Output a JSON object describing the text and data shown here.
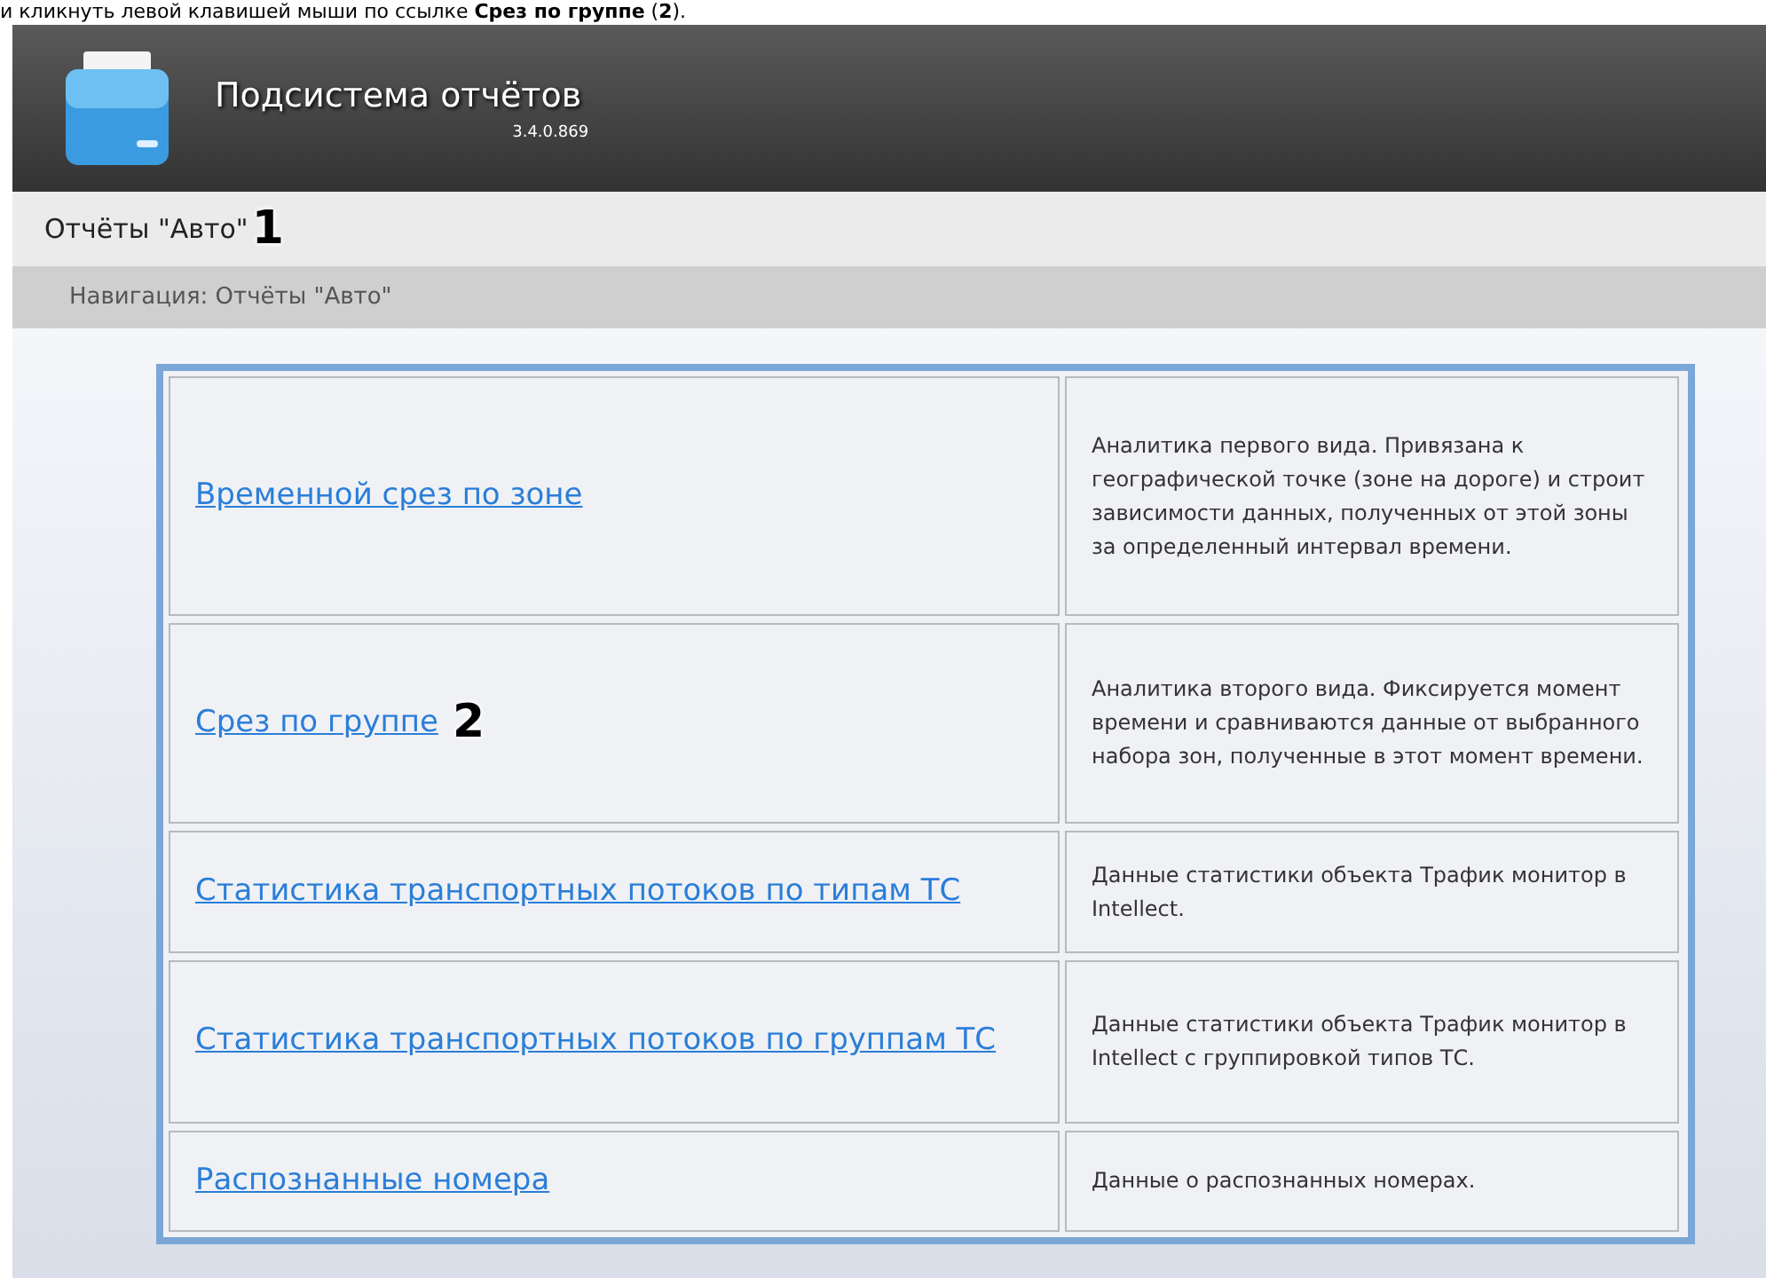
{
  "instruction": "и кликнуть левой клавишей мыши по ссылке **Срез по группе** (**2**).",
  "header": {
    "title": "Подсистема отчётов",
    "version": "3.4.0.869"
  },
  "page_title": {
    "text": "Отчёты \"Авто\"",
    "marker": "1"
  },
  "breadcrumb": "Навигация: Отчёты \"Авто\"",
  "reports": [
    {
      "link": "Временной срез по зоне",
      "description": "Аналитика первого вида. Привязана к географической точке (зоне на дороге) и строит зависимости данных, полученных от этой зоны за определенный интервал времени."
    },
    {
      "link": "Срез по группе",
      "marker": "2",
      "description": "Аналитика второго вида. Фиксируется момент времени и сравниваются данные от выбранного набора зон, полученные в этот момент времени."
    },
    {
      "link": "Статистика транспортных потоков по типам ТС",
      "description": "Данные статистики объекта Трафик монитор в Intellect."
    },
    {
      "link": "Статистика транспортных потоков по группам ТС",
      "description": "Данные статистики объекта Трафик монитор в Intellect с группировкой типов ТС."
    },
    {
      "link": "Распознанные номера",
      "description": "Данные о распознанных номерах."
    }
  ]
}
